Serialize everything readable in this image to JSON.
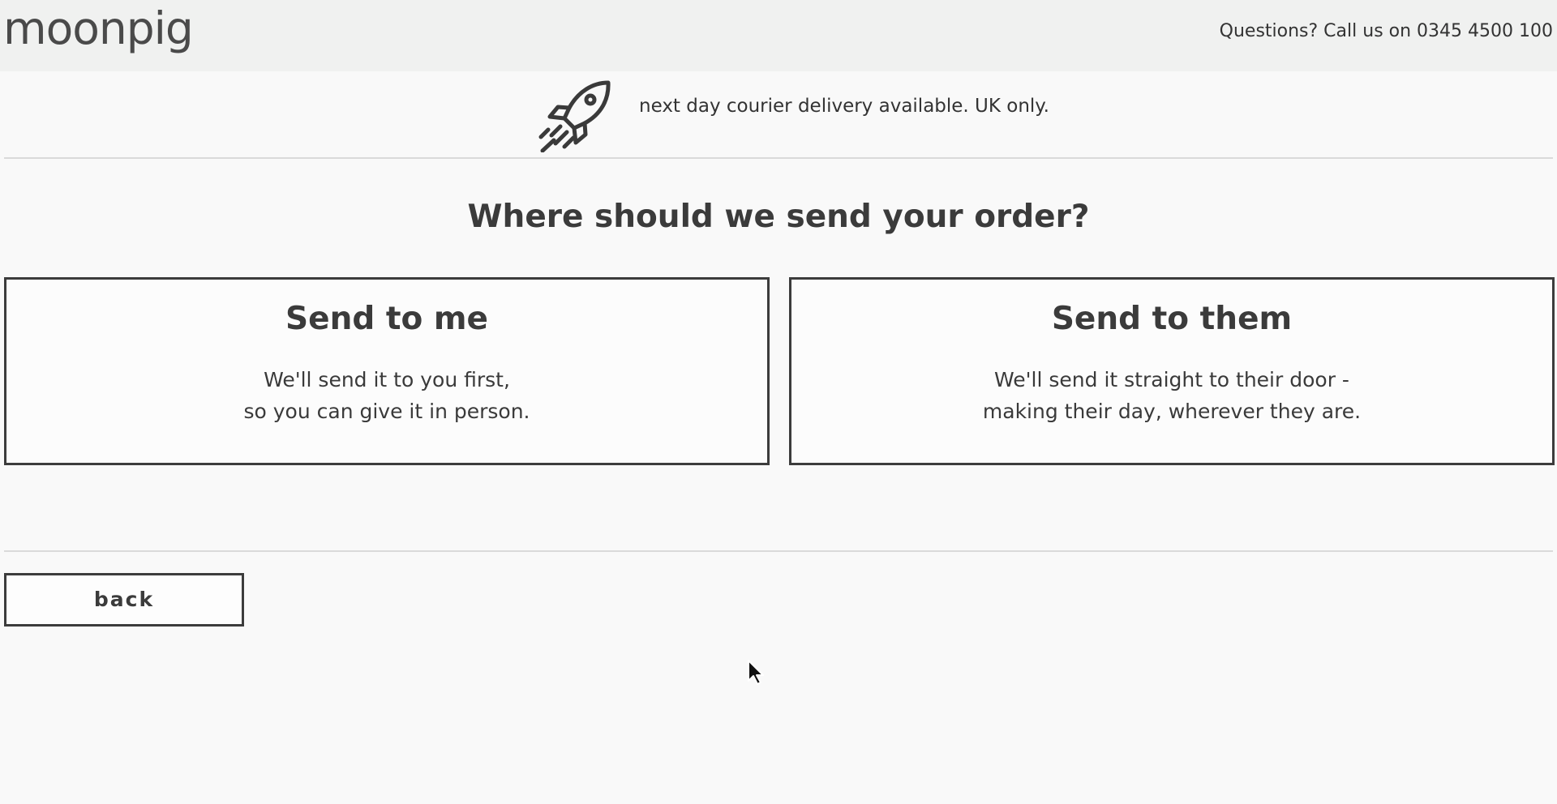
{
  "header": {
    "logo_text": "moonpig",
    "phone_text": "Questions? Call us on 0345 4500 100"
  },
  "delivery_banner": {
    "icon": "rocket-icon",
    "text": "next day courier delivery available. UK only."
  },
  "main": {
    "heading": "Where should we send your order?",
    "options": [
      {
        "title": "Send to me",
        "line1": "We'll send it to you first,",
        "line2": "so you can give it in person."
      },
      {
        "title": "Send to them",
        "line1": "We'll send it straight to their door -",
        "line2": "making their day, wherever they are."
      }
    ]
  },
  "footer": {
    "back_label": "back"
  },
  "colors": {
    "background": "#f9f9f9",
    "header_background": "#f0f1f0",
    "text": "#3b3b3b",
    "border": "#3c3c3c"
  }
}
